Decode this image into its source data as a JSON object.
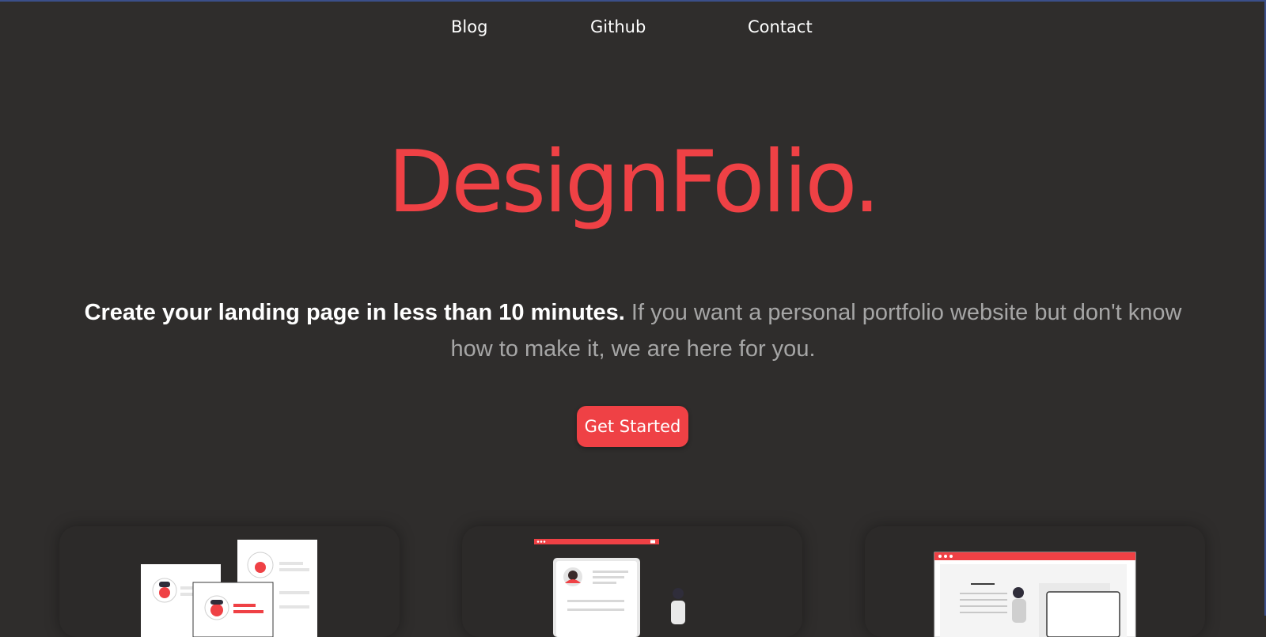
{
  "nav": {
    "items": [
      "Blog",
      "Github",
      "Contact"
    ]
  },
  "hero": {
    "title": "DesignFolio.",
    "tagline_strong": "Create your landing page in less than 10 minutes.",
    "tagline_muted": "If you want a personal portfolio website but don't know how to make it, we are here for you.",
    "cta_label": "Get Started"
  },
  "colors": {
    "background": "#2f2d2c",
    "accent": "#ef4145",
    "text": "#ffffff",
    "muted_text": "#a6a6a6",
    "card": "#2c2a29"
  },
  "cards": [
    {
      "illustration": "profile-cards-illustration"
    },
    {
      "illustration": "resume-page-illustration"
    },
    {
      "illustration": "browser-window-illustration"
    }
  ]
}
